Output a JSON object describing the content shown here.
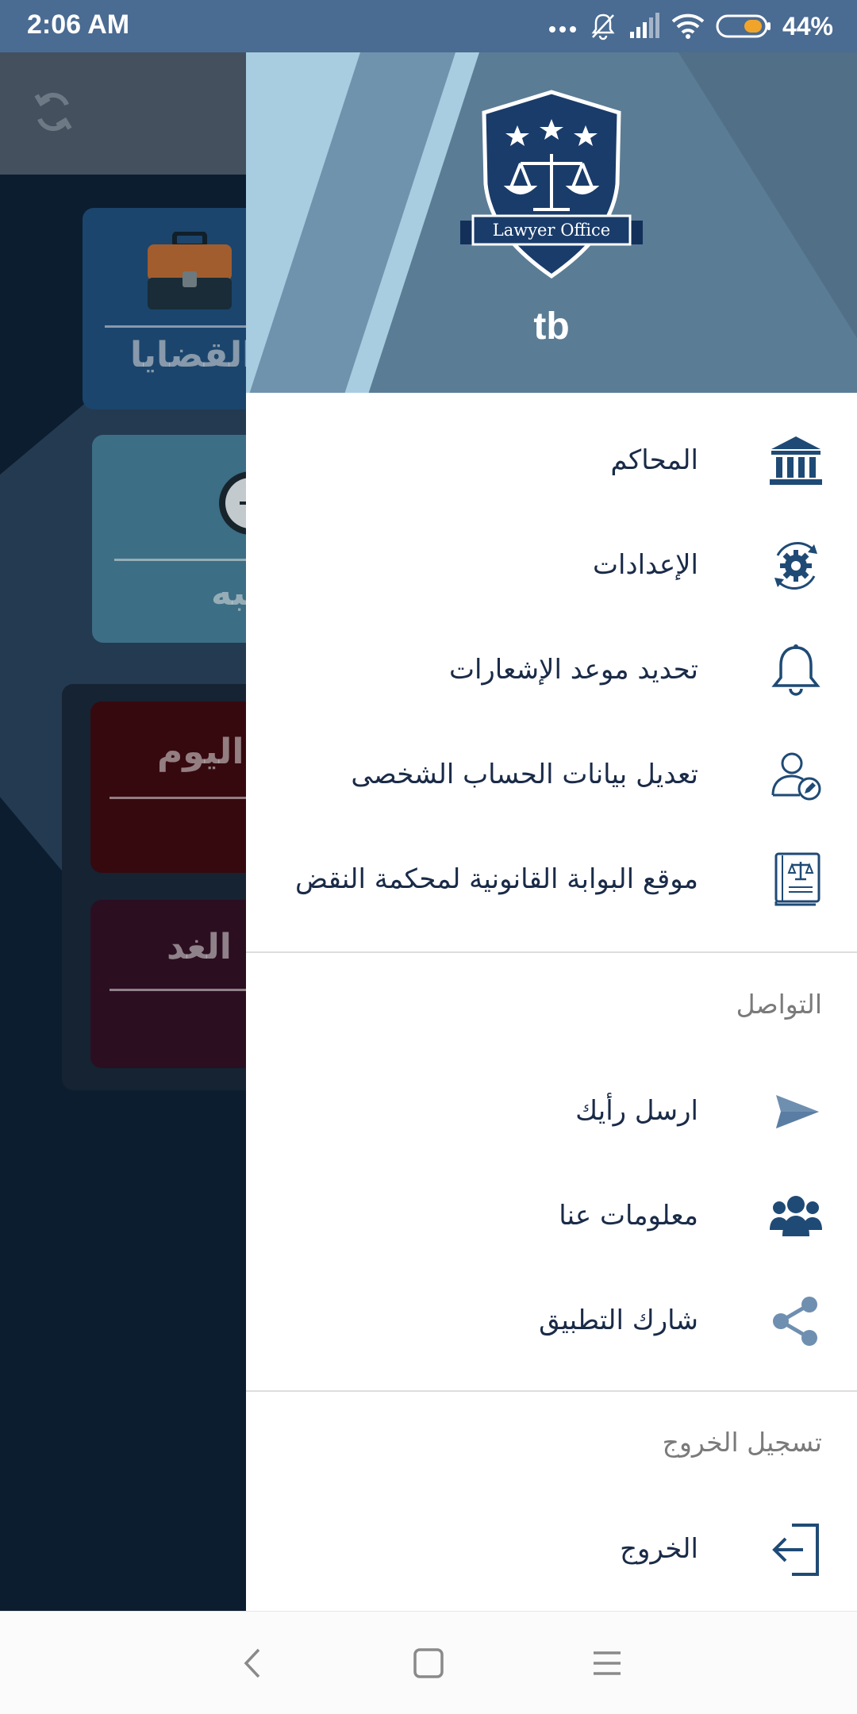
{
  "status_bar": {
    "time": "2:06 AM",
    "battery_percent": "44%",
    "icons": [
      "more-dots-icon",
      "muted-bell-icon",
      "signal-icon",
      "wifi-icon",
      "battery-icon"
    ]
  },
  "background_app": {
    "cards": [
      {
        "label": "القضايا",
        "icon": "briefcase-icon"
      },
      {
        "label": "منبه",
        "icon": "alarm-clock-icon"
      },
      {
        "label": "اليوم"
      },
      {
        "label": "الغد"
      }
    ]
  },
  "drawer": {
    "logo_text": "Lawyer Office",
    "username": "tb",
    "menu_items": [
      {
        "label": "المحاكم",
        "icon": "courthouse-icon"
      },
      {
        "label": "الإعدادات",
        "icon": "settings-gear-icon"
      },
      {
        "label": "تحديد موعد الإشعارات",
        "icon": "bell-icon"
      },
      {
        "label": "تعديل بيانات الحساب الشخصى",
        "icon": "edit-profile-icon"
      },
      {
        "label": "موقع البوابة القانونية لمحكمة النقض",
        "icon": "law-book-icon"
      }
    ],
    "communication_section": {
      "title": "التواصل",
      "items": [
        {
          "label": "ارسل رأيك",
          "icon": "send-icon"
        },
        {
          "label": "معلومات عنا",
          "icon": "group-icon"
        },
        {
          "label": "شارك التطبيق",
          "icon": "share-icon"
        }
      ]
    },
    "logout_section": {
      "title": "تسجيل الخروج",
      "items": [
        {
          "label": "الخروج",
          "icon": "logout-icon"
        }
      ]
    }
  },
  "colors": {
    "status_bar": "#4a6b92",
    "menu_text": "#1a2b48",
    "icon": "#1f4a75",
    "header": "#5b7c95"
  }
}
